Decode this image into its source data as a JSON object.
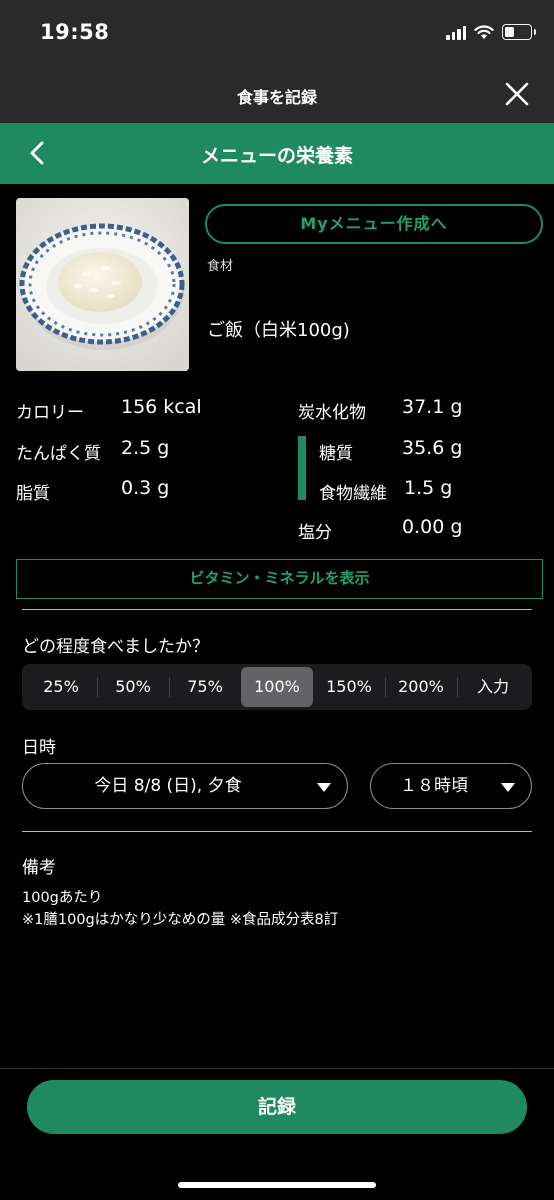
{
  "status_bar": {
    "time": "19:58"
  },
  "modal": {
    "title": "食事を記録"
  },
  "nav": {
    "title": "メニューの栄養素"
  },
  "food": {
    "my_menu_button": "Myメニュー作成へ",
    "ingredient_label": "食材",
    "name": "ご飯（白米100g)"
  },
  "nutrients": {
    "calorie": {
      "label": "カロリー",
      "value": "156 kcal"
    },
    "protein": {
      "label": "たんぱく質",
      "value": "2.5 g"
    },
    "fat": {
      "label": "脂質",
      "value": "0.3 g"
    },
    "carbohydrate": {
      "label": "炭水化物",
      "value": "37.1 g"
    },
    "sugar": {
      "label": "糖質",
      "value": "35.6 g"
    },
    "fiber": {
      "label": "食物繊維",
      "value": "1.5 g"
    },
    "salt": {
      "label": "塩分",
      "value": "0.00 g"
    }
  },
  "vitamin_button": "ビタミン・ミネラルを表示",
  "portion": {
    "question": "どの程度食べましたか？",
    "options": [
      "25%",
      "50%",
      "75%",
      "100%",
      "150%",
      "200%",
      "入力"
    ],
    "selected": "100%"
  },
  "datetime": {
    "label": "日時",
    "date_value": "今日 8/8 (日), 夕食",
    "time_value": "１８時頃"
  },
  "notes": {
    "label": "備考",
    "line1": "100gあたり",
    "line2": "※1膳100gはかなり少なめの量 ※食品成分表8訂"
  },
  "record_button": "記録",
  "colors": {
    "accent": "#1f8a5f",
    "accent_text": "#21a06b",
    "background": "#000000",
    "header": "#2a2a2a"
  }
}
